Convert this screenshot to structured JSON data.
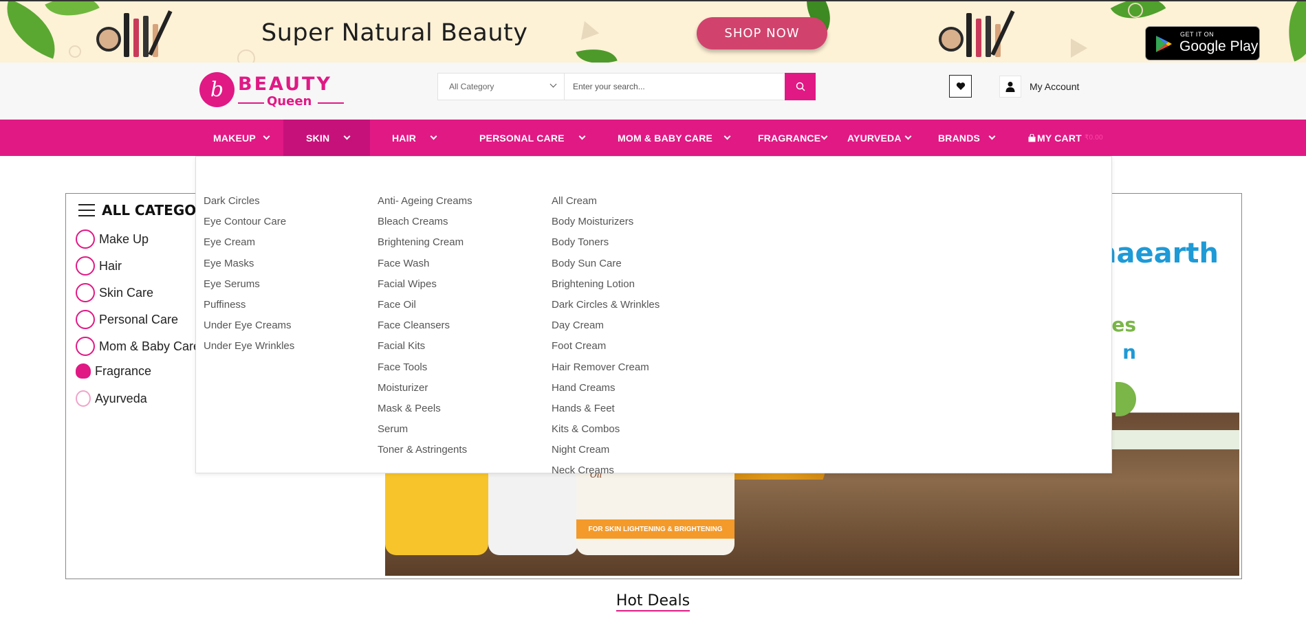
{
  "promo": {
    "title": "Super Natural Beauty",
    "shop_now": "SHOP NOW",
    "gplay_small": "GET IT ON",
    "gplay_big": "Google Play"
  },
  "header": {
    "logo_letter": "b",
    "logo_word1": "BEAUTY",
    "logo_word2": "Queen",
    "search": {
      "category": "All Category",
      "placeholder": "Enter your search...",
      "value": ""
    },
    "account_label": "My Account"
  },
  "nav": {
    "items": [
      {
        "label": "MAKEUP"
      },
      {
        "label": "SKIN"
      },
      {
        "label": "HAIR"
      },
      {
        "label": "PERSONAL CARE"
      },
      {
        "label": "MOM & BABY CARE"
      },
      {
        "label": "FRAGRANCE"
      },
      {
        "label": "AYURVEDA"
      },
      {
        "label": "BRANDS"
      }
    ],
    "cart_label": "MY CART",
    "cart_amount": "₹0.00",
    "active": "SKIN"
  },
  "sidebar": {
    "title": "ALL CATEGORIES",
    "items": [
      {
        "label": "Make Up",
        "icon": "makeup-icon"
      },
      {
        "label": "Hair",
        "icon": "hair-icon"
      },
      {
        "label": "Skin Care",
        "icon": "skin-care-icon"
      },
      {
        "label": "Personal Care",
        "icon": "personal-care-icon"
      },
      {
        "label": "Mom & Baby Care",
        "icon": "mom-baby-icon"
      },
      {
        "label": "Fragrance",
        "icon": "fragrance-icon"
      },
      {
        "label": "Ayurveda",
        "icon": "ayurveda-icon"
      }
    ]
  },
  "hero": {
    "brand": "mamaearth",
    "jar_band": "FOR SKIN LIGHTENING & BRIGHTENING",
    "jar_script": "with Saffron, Turmeric & Apricot Oil"
  },
  "mega": {
    "col1": [
      "Dark Circles",
      "Eye Contour Care",
      "Eye Cream",
      "Eye Masks",
      "Eye Serums",
      "Puffiness",
      "Under Eye Creams",
      "Under Eye Wrinkles"
    ],
    "col2": [
      "Anti- Ageing Creams",
      "Bleach Creams",
      "Brightening Cream",
      "Face Wash",
      "Facial Wipes",
      "Face Oil",
      "Face Cleansers",
      "Facial Kits",
      "Face Tools",
      "Moisturizer",
      "Mask & Peels",
      "Serum",
      "Toner & Astringents"
    ],
    "col3": [
      "All Cream",
      "Body Moisturizers",
      "Body Toners",
      "Body Sun Care",
      "Brightening Lotion",
      "Dark Circles & Wrinkles",
      "Day Cream",
      "Foot Cream",
      "Hair Remover Cream",
      "Hand Creams",
      "Hands & Feet",
      "Kits & Combos",
      "Night Cream",
      "Neck Creams"
    ]
  },
  "hot_deals": "Hot Deals",
  "colors": {
    "brand_pink": "#e01985",
    "nav_active": "#c7117a",
    "promo_bg": "#fdf1d6"
  }
}
